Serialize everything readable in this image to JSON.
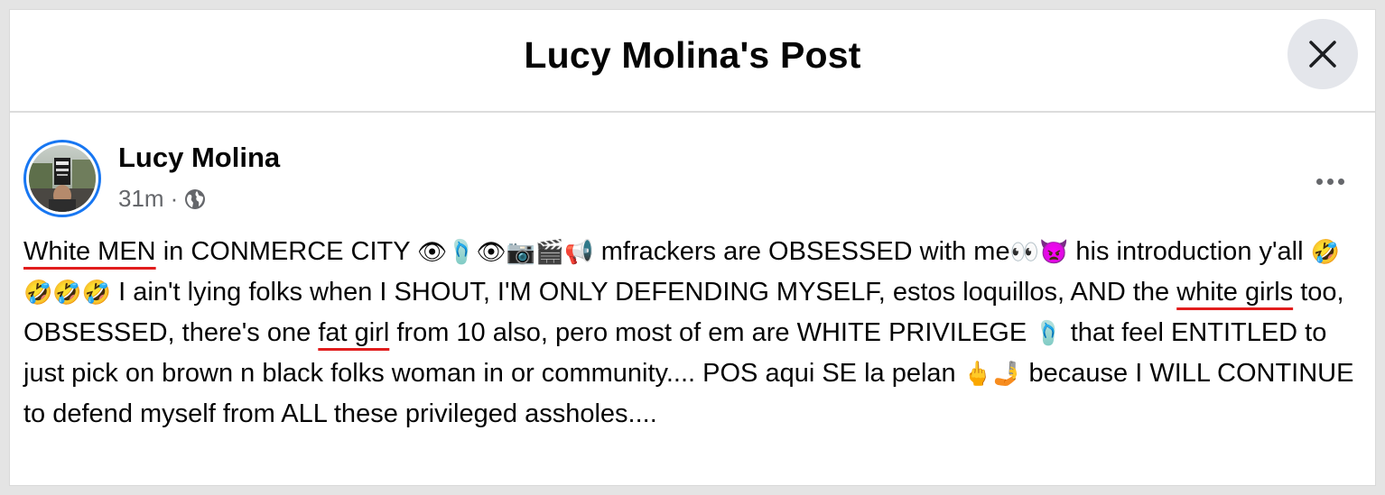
{
  "dialog": {
    "title": "Lucy Molina's Post",
    "close_icon": "close-icon"
  },
  "post": {
    "author": "Lucy Molina",
    "timestamp": "31m",
    "separator": "·",
    "privacy_icon": "globe-icon",
    "menu_icon": "more-options-icon",
    "accent_color": "#1877f2",
    "underline_color": "#e11d1d",
    "segments": {
      "s1": "White MEN",
      "s2": " in CONMERCE CITY ",
      "e1": "👁🩴👁📷🎬📢",
      "s3": " mfrackers are OBSESSED with me",
      "e2": "👀👿",
      "s4": " his introduction y'all ",
      "e3": "🤣🤣🤣🤣",
      "s5": " I ain't lying folks when I SHOUT, I'M ONLY DEFENDING MYSELF, estos loquillos, AND the ",
      "s6": "white girls",
      "s7": " too, OBSESSED, there's one ",
      "s8": "fat girl",
      "s9": " from 10 also, pero most of em are WHITE PRIVILEGE ",
      "e4": "🩴",
      "s10": " that feel ENTITLED to just pick on brown n black folks woman in or community.... POS aqui SE la pelan ",
      "e5": "🖕🤳",
      "s11": " because I WILL CONTINUE to defend myself from ALL these privileged assholes...."
    }
  }
}
